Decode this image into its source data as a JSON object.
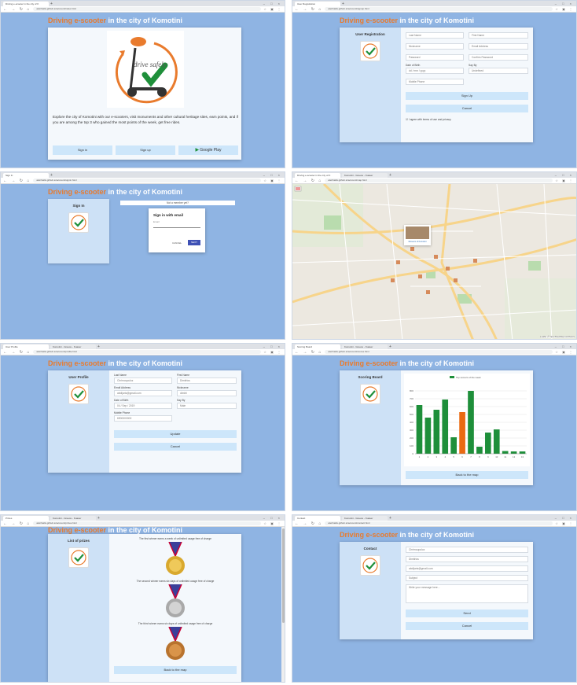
{
  "browser": {
    "window_controls": "– □ ×",
    "nav_buttons": "← → ↻ ⌂",
    "extensions": "☆ ▣ ⋮"
  },
  "page_title": {
    "highlight": "Driving e-scooter",
    "rest": " in the city of Komotini"
  },
  "shots": {
    "home": {
      "tabs": [
        "Driving e-scooter in the city of K",
        "+"
      ],
      "url": "aleirhailis.github.io/account/index.html",
      "logo_text": "drive safely",
      "description": "Explore the city of Komotini with our e-scooters, visit monuments and other cultural heritage sites, earn points, and if you are among the top 3 who gained the most points of the week, get free rides.",
      "buttons": [
        "Sign in",
        "Sign up",
        "Google Play"
      ]
    },
    "registration": {
      "tabs": [
        "User Registration",
        "+"
      ],
      "url": "aleirhailis.github.io/account/signup.html",
      "side_title": "User Registration",
      "fields": {
        "last_name": "Last Name",
        "first_name": "First Name",
        "nickname": "Nickname",
        "email": "Email Address",
        "password": "Password",
        "confirm_password": "Confirm Password",
        "dob_label": "Date of Birth",
        "dob_value": "dd / mm / yyyy",
        "sex_label": "Say By",
        "sex_value": "Undefined",
        "mobile": "Mobile Phone"
      },
      "buttons": [
        "Sign Up",
        "Cancel"
      ],
      "agree": "I agree with terms of use and privacy"
    },
    "signin": {
      "tabs": [
        "Sign In",
        "+"
      ],
      "url": "aleirhailis.github.io/account/signin.html",
      "side_title": "Sign In",
      "banner": "Not a member yet?",
      "dialog_title": "Sign in with email",
      "email_label": "Email",
      "cancel": "CANCEL",
      "next": "NEXT"
    },
    "map": {
      "tabs": [
        "Driving e-scooter in the city of K",
        "Komotini - Greece - Kuaser",
        "+"
      ],
      "url": "aleirhailis.github.io/account/map.html",
      "popup": "Museum of Komotini",
      "attribution": "Leaflet | © OpenStreetMap contributors"
    },
    "profile": {
      "tabs": [
        "User Profile",
        "Komotini - Greece - Kuaser",
        "+"
      ],
      "url": "aleirhailis.github.io/account/profile.html",
      "side_title": "User Profile",
      "fields": {
        "last_name_label": "Last Name",
        "last_name": "Chrimoupuloz",
        "first_name_label": "First Name",
        "first_name": "Dimitrios",
        "email_label": "Email Address",
        "email": "abdijaris@gmail.com",
        "nickname_label": "Nickname",
        "nickname": "dimitri",
        "dob_label": "Date of Birth",
        "dob": "04 / Sep / 2019",
        "sex_label": "Say By",
        "sex": "Male",
        "mobile_label": "Mobile Phone",
        "mobile": "6900000000"
      },
      "buttons": [
        "Update",
        "Cancel"
      ]
    },
    "scoring": {
      "tabs": [
        "Scoring Board",
        "Komotini - Greece - Kuaser",
        "+"
      ],
      "url": "aleirhailis.github.io/account/scores.html",
      "side_title": "Scoring Board",
      "back": "Back to the map"
    },
    "prizes": {
      "tabs": [
        "Prizes",
        "Komotini - Greece - Kuaser",
        "+"
      ],
      "url": "aleirhailis.github.io/account/prizes.html",
      "side_title": "List of prizes",
      "prizes": [
        "The first winner earns a week of unlimited usage free of charge",
        "The second winner earns six days of unlimited usage free of charge",
        "The third winner earns six days of unlimited usage free of charge"
      ],
      "back": "Back to the map"
    },
    "contact": {
      "tabs": [
        "Contact",
        "Komotini - Greece - Kuaser",
        "+"
      ],
      "url": "aleirhailis.github.io/account/contact.html",
      "side_title": "Contact",
      "fields": {
        "name": "Chrimoupuloz",
        "surname": "Dimitrios",
        "email": "abdijaris@gmail.com",
        "subject": "Subject",
        "message": "Write your message here..."
      },
      "buttons": [
        "Send",
        "Cancel"
      ]
    }
  },
  "chart_data": {
    "type": "bar",
    "title": "",
    "legend": [
      "Top scorers of the week"
    ],
    "categories": [
      "1",
      "2",
      "3",
      "4",
      "5",
      "6",
      "7",
      "8",
      "9",
      "10",
      "11",
      "12",
      "13"
    ],
    "values": [
      620,
      460,
      560,
      690,
      210,
      530,
      800,
      90,
      270,
      310,
      35,
      30,
      30
    ],
    "highlighted_index": 5,
    "colors": {
      "normal": "#1e8f3a",
      "highlight": "#ea6a12"
    },
    "yticks": [
      "0",
      "100",
      "200",
      "300",
      "400",
      "500",
      "600",
      "700",
      "800"
    ],
    "ylim": [
      0,
      900
    ],
    "grid": true,
    "legend_position": "top"
  },
  "colors": {
    "page_bg": "#8fb4e3",
    "accent": "#e97b2d",
    "button": "#cde6fa",
    "green": "#1e8f3a"
  }
}
